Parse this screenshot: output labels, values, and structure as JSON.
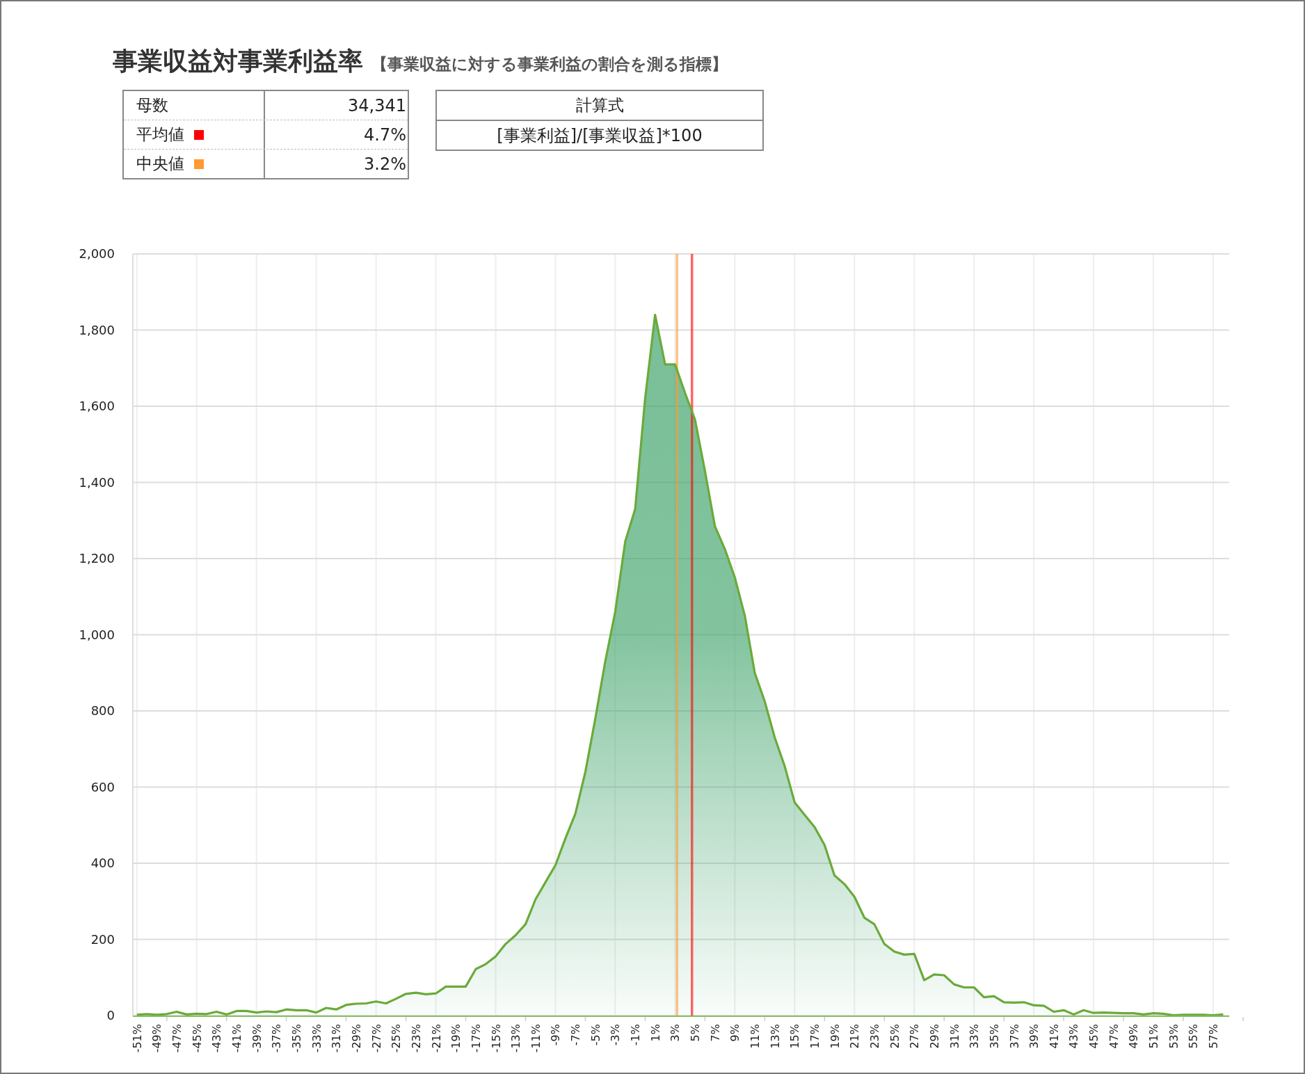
{
  "title": "事業収益対事業利益率",
  "subtitle": "【事業収益に対する事業利益の割合を測る指標】",
  "stats": [
    {
      "label": "母数",
      "value": "34,341"
    },
    {
      "label": "平均値",
      "value": "4.7%",
      "color": "#ff0000"
    },
    {
      "label": "中央値",
      "value": "3.2%",
      "color": "#ff9933"
    }
  ],
  "formula": {
    "header": "計算式",
    "expression": "[事業利益]/[事業収益]*100"
  },
  "chart": {
    "chart_data": {
      "type": "area",
      "xlim": [
        -51.4,
        58.6
      ],
      "ylim": [
        0,
        2000
      ],
      "x": [
        -51,
        -50,
        -49,
        -48,
        -47,
        -46,
        -45,
        -44,
        -43,
        -42,
        -41,
        -40,
        -39,
        -38,
        -37,
        -36,
        -35,
        -34,
        -33,
        -32,
        -31,
        -30,
        -29,
        -28,
        -27,
        -26,
        -25,
        -24,
        -23,
        -22,
        -21,
        -20,
        -19,
        -18,
        -17,
        -16,
        -15,
        -14,
        -13,
        -12,
        -11,
        -10,
        -9,
        -8,
        -7,
        -6,
        -5,
        -4,
        -3,
        -2,
        -1,
        0,
        1,
        2,
        3,
        4,
        5,
        6,
        7,
        8,
        9,
        10,
        11,
        12,
        13,
        14,
        15,
        16,
        17,
        18,
        19,
        20,
        21,
        22,
        23,
        24,
        25,
        26,
        27,
        28,
        29,
        30,
        31,
        32,
        33,
        34,
        35,
        36,
        37,
        38,
        39,
        40,
        41,
        42,
        43,
        44,
        45,
        46,
        47,
        48,
        49,
        50,
        51,
        52,
        53,
        54,
        55,
        56,
        57,
        58
      ],
      "values": [
        2,
        4,
        2,
        4,
        10,
        3,
        5,
        4,
        10,
        3,
        12,
        12,
        8,
        11,
        9,
        16,
        14,
        14,
        8,
        20,
        16,
        28,
        31,
        32,
        37,
        32,
        44,
        57,
        60,
        56,
        58,
        76,
        76,
        76,
        122,
        135,
        155,
        188,
        211,
        240,
        305,
        350,
        395,
        465,
        530,
        640,
        780,
        930,
        1060,
        1245,
        1330,
        1620,
        1840,
        1710,
        1710,
        1635,
        1565,
        1430,
        1285,
        1225,
        1150,
        1050,
        900,
        825,
        730,
        655,
        560,
        527,
        495,
        448,
        368,
        345,
        312,
        257,
        240,
        188,
        168,
        160,
        162,
        93,
        108,
        106,
        82,
        74,
        74,
        48,
        51,
        35,
        34,
        35,
        27,
        26,
        10,
        14,
        3,
        14,
        7,
        8,
        7,
        6,
        6,
        3,
        6,
        5,
        1,
        2,
        2,
        2,
        1,
        3
      ],
      "yticks": [
        {
          "value": 0,
          "label": "0"
        },
        {
          "value": 200,
          "label": "200"
        },
        {
          "value": 400,
          "label": "400"
        },
        {
          "value": 600,
          "label": "600"
        },
        {
          "value": 800,
          "label": "800"
        },
        {
          "value": 1000,
          "label": "1,000"
        },
        {
          "value": 1200,
          "label": "1,200"
        },
        {
          "value": 1400,
          "label": "1,400"
        },
        {
          "value": 1600,
          "label": "1,600"
        },
        {
          "value": 1800,
          "label": "1,800"
        },
        {
          "value": 2000,
          "label": "2,000"
        }
      ],
      "xticks": [
        {
          "value": -51,
          "label": "-51%"
        },
        {
          "value": -49,
          "label": "-49%"
        },
        {
          "value": -47,
          "label": "-47%"
        },
        {
          "value": -45,
          "label": "-45%"
        },
        {
          "value": -43,
          "label": "-43%"
        },
        {
          "value": -41,
          "label": "-41%"
        },
        {
          "value": -39,
          "label": "-39%"
        },
        {
          "value": -37,
          "label": "-37%"
        },
        {
          "value": -35,
          "label": "-35%"
        },
        {
          "value": -33,
          "label": "-33%"
        },
        {
          "value": -31,
          "label": "-31%"
        },
        {
          "value": -29,
          "label": "-29%"
        },
        {
          "value": -27,
          "label": "-27%"
        },
        {
          "value": -25,
          "label": "-25%"
        },
        {
          "value": -23,
          "label": "-23%"
        },
        {
          "value": -21,
          "label": "-21%"
        },
        {
          "value": -19,
          "label": "-19%"
        },
        {
          "value": -17,
          "label": "-17%"
        },
        {
          "value": -15,
          "label": "-15%"
        },
        {
          "value": -13,
          "label": "-13%"
        },
        {
          "value": -11,
          "label": "-11%"
        },
        {
          "value": -9,
          "label": "-9%"
        },
        {
          "value": -7,
          "label": "-7%"
        },
        {
          "value": -5,
          "label": "-5%"
        },
        {
          "value": -3,
          "label": "-3%"
        },
        {
          "value": -1,
          "label": "-1%"
        },
        {
          "value": 1,
          "label": "1%"
        },
        {
          "value": 3,
          "label": "3%"
        },
        {
          "value": 5,
          "label": "5%"
        },
        {
          "value": 7,
          "label": "7%"
        },
        {
          "value": 9,
          "label": "9%"
        },
        {
          "value": 11,
          "label": "11%"
        },
        {
          "value": 13,
          "label": "13%"
        },
        {
          "value": 15,
          "label": "15%"
        },
        {
          "value": 17,
          "label": "17%"
        },
        {
          "value": 19,
          "label": "19%"
        },
        {
          "value": 21,
          "label": "21%"
        },
        {
          "value": 23,
          "label": "23%"
        },
        {
          "value": 25,
          "label": "25%"
        },
        {
          "value": 27,
          "label": "27%"
        },
        {
          "value": 29,
          "label": "29%"
        },
        {
          "value": 31,
          "label": "31%"
        },
        {
          "value": 33,
          "label": "33%"
        },
        {
          "value": 35,
          "label": "35%"
        },
        {
          "value": 37,
          "label": "37%"
        },
        {
          "value": 39,
          "label": "39%"
        },
        {
          "value": 41,
          "label": "41%"
        },
        {
          "value": 43,
          "label": "43%"
        },
        {
          "value": 45,
          "label": "45%"
        },
        {
          "value": 47,
          "label": "47%"
        },
        {
          "value": 49,
          "label": "49%"
        },
        {
          "value": 51,
          "label": "51%"
        },
        {
          "value": 53,
          "label": "53%"
        },
        {
          "value": 55,
          "label": "55%"
        },
        {
          "value": 57,
          "label": "57%"
        }
      ],
      "grid": true,
      "ref_lines": [
        {
          "axis": "x",
          "value": 3.2,
          "color": "#ff9933"
        },
        {
          "axis": "x",
          "value": 4.7,
          "color": "#ff0000"
        }
      ]
    }
  }
}
